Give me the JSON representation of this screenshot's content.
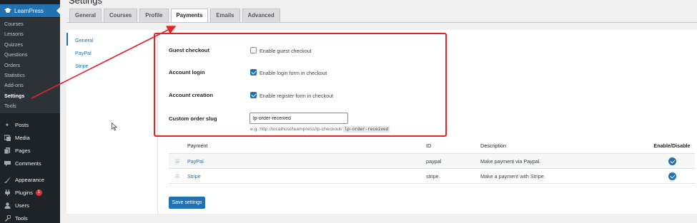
{
  "page": {
    "title": "Settings"
  },
  "sidebar": {
    "plugin_label": "LearnPress",
    "submenu": [
      {
        "label": "Courses"
      },
      {
        "label": "Lessons"
      },
      {
        "label": "Quizzes"
      },
      {
        "label": "Questions"
      },
      {
        "label": "Orders"
      },
      {
        "label": "Statistics"
      },
      {
        "label": "Add-ons"
      },
      {
        "label": "Settings",
        "active": true
      },
      {
        "label": "Tools"
      }
    ],
    "menu": [
      {
        "label": "Posts",
        "icon": "pin-icon"
      },
      {
        "label": "Media",
        "icon": "media-icon"
      },
      {
        "label": "Pages",
        "icon": "pages-icon"
      },
      {
        "label": "Comments",
        "icon": "comment-icon"
      },
      {
        "label": "Appearance",
        "icon": "brush-icon"
      },
      {
        "label": "Plugins",
        "icon": "plugin-icon",
        "badge": "1"
      },
      {
        "label": "Users",
        "icon": "user-icon"
      },
      {
        "label": "Tools",
        "icon": "wrench-icon"
      }
    ]
  },
  "tabs": [
    "General",
    "Courses",
    "Profile",
    "Payments",
    "Emails",
    "Advanced"
  ],
  "active_tab": "Payments",
  "vertical_nav": [
    "General",
    "PayPal",
    "Stripe"
  ],
  "form": {
    "guest_checkout": {
      "label": "Guest checkout",
      "option": "Enable guest checkout",
      "checked": false
    },
    "account_login": {
      "label": "Account login",
      "option": "Enable login form in checkout",
      "checked": true
    },
    "account_creation": {
      "label": "Account creation",
      "option": "Enable register form in checkout",
      "checked": true
    },
    "order_slug": {
      "label": "Custom order slug",
      "value": "lp-order-received",
      "hint_prefix": "e.g. http://localhost/leampress/lp-checkout/",
      "hint_code": "lp-order-received"
    }
  },
  "payments_table": {
    "headers": {
      "name": "Payment",
      "id": "ID",
      "description": "Description",
      "enable": "Enable/Disable"
    },
    "rows": [
      {
        "name": "PayPal",
        "id": "paypal",
        "description": "Make payment via Paypal.",
        "enabled": true
      },
      {
        "name": "Stripe",
        "id": "stripe",
        "description": "Make a payment with Stripe.",
        "enabled": true
      }
    ]
  },
  "buttons": {
    "save": "Save settings"
  },
  "colors": {
    "accent": "#2271b1",
    "annotation": "#e2242b",
    "sidebar": "#1d2327"
  }
}
